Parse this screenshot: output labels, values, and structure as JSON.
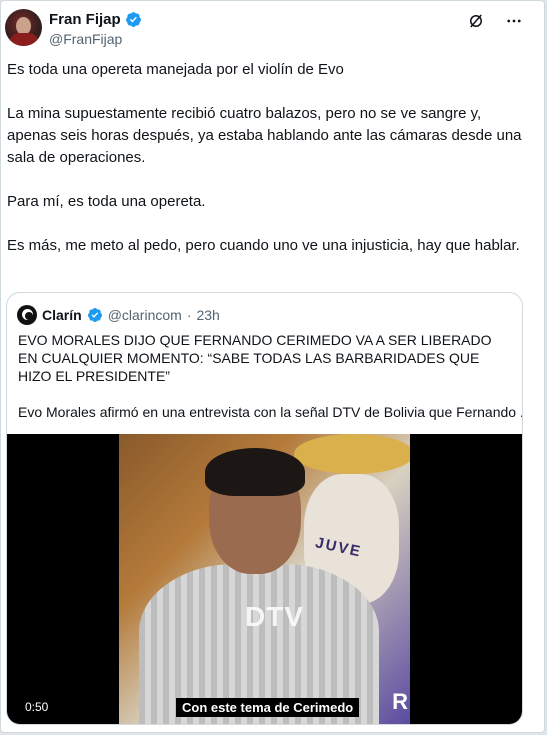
{
  "author": {
    "name": "Fran Fijap",
    "handle": "@FranFijap"
  },
  "tweet": {
    "paragraphs": [
      "Es toda una opereta manejada por el violín de Evo",
      "La mina supuestamente recibió cuatro balazos, pero no se ve sangre y, apenas seis horas después, ya estaba hablando ante las cámaras desde una sala de operaciones.",
      "Para mí, es toda una opereta.",
      "Es más, me meto al pedo, pero cuando uno ve una injusticia, hay que hablar."
    ]
  },
  "quote": {
    "name": "Clarín",
    "handle": "@clarincom",
    "separator": "·",
    "time": "23h",
    "headline": "EVO MORALES DIJO QUE FERNANDO CERIMEDO VA A SER LIBERADO EN CUALQUIER MOMENTO: “SABE TODAS LAS BARBARIDADES QUE HIZO EL PRESIDENTE”",
    "description": "Evo Morales afirmó en una entrevista con la señal DTV de Bolivia que Fernando ...",
    "video": {
      "duration": "0:50",
      "subtitle": "Con este tema de Cerimedo",
      "watermark": "DTV",
      "bg_text": "JUVE",
      "corner_text": "R"
    }
  },
  "colors": {
    "verified": "#1d9bf0",
    "muted": "#536471",
    "border": "#cfd9de"
  },
  "icons": [
    "verified-badge-icon",
    "grok-icon",
    "more-icon"
  ]
}
